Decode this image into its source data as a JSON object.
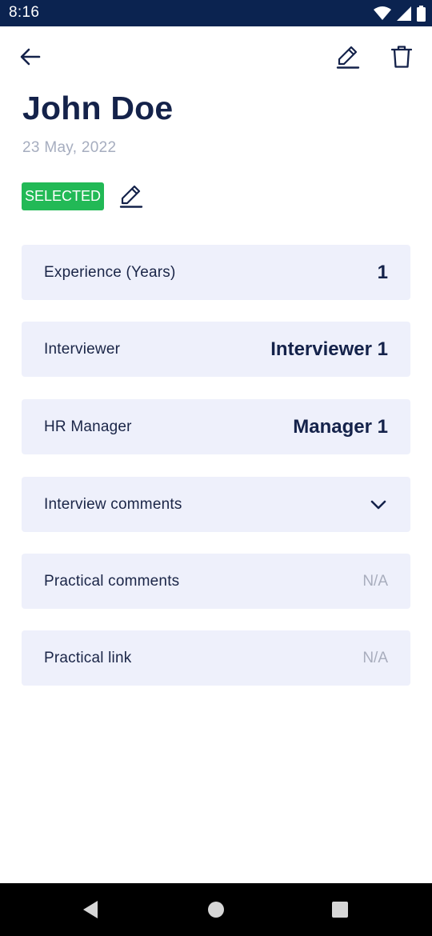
{
  "status_bar": {
    "time": "8:16",
    "icons": [
      "wifi-icon",
      "cell-signal-icon",
      "battery-icon"
    ]
  },
  "toolbar": {
    "back_icon": "arrow-left-icon",
    "edit_icon": "pencil-icon",
    "delete_icon": "trash-icon"
  },
  "candidate": {
    "name": "John Doe",
    "date": "23 May, 2022",
    "status": "SELECTED",
    "status_color": "#22b956"
  },
  "details": [
    {
      "label": "Experience (Years)",
      "value": "1"
    },
    {
      "label": "Interviewer",
      "value": "Interviewer 1"
    },
    {
      "label": "HR Manager",
      "value": "Manager 1"
    },
    {
      "label": "Interview comments",
      "icon": "chevron-down-icon"
    },
    {
      "label": "Practical comments",
      "value": "N/A"
    },
    {
      "label": "Practical link",
      "value": "N/A"
    }
  ],
  "colors": {
    "status_bar_bg": "#0b2350",
    "text_primary": "#14224a",
    "card_bg": "#eef0fb",
    "muted": "#a8adbd"
  },
  "nav_bar": {
    "back": "nav-back-icon",
    "home": "nav-home-icon",
    "recents": "nav-recents-icon"
  }
}
